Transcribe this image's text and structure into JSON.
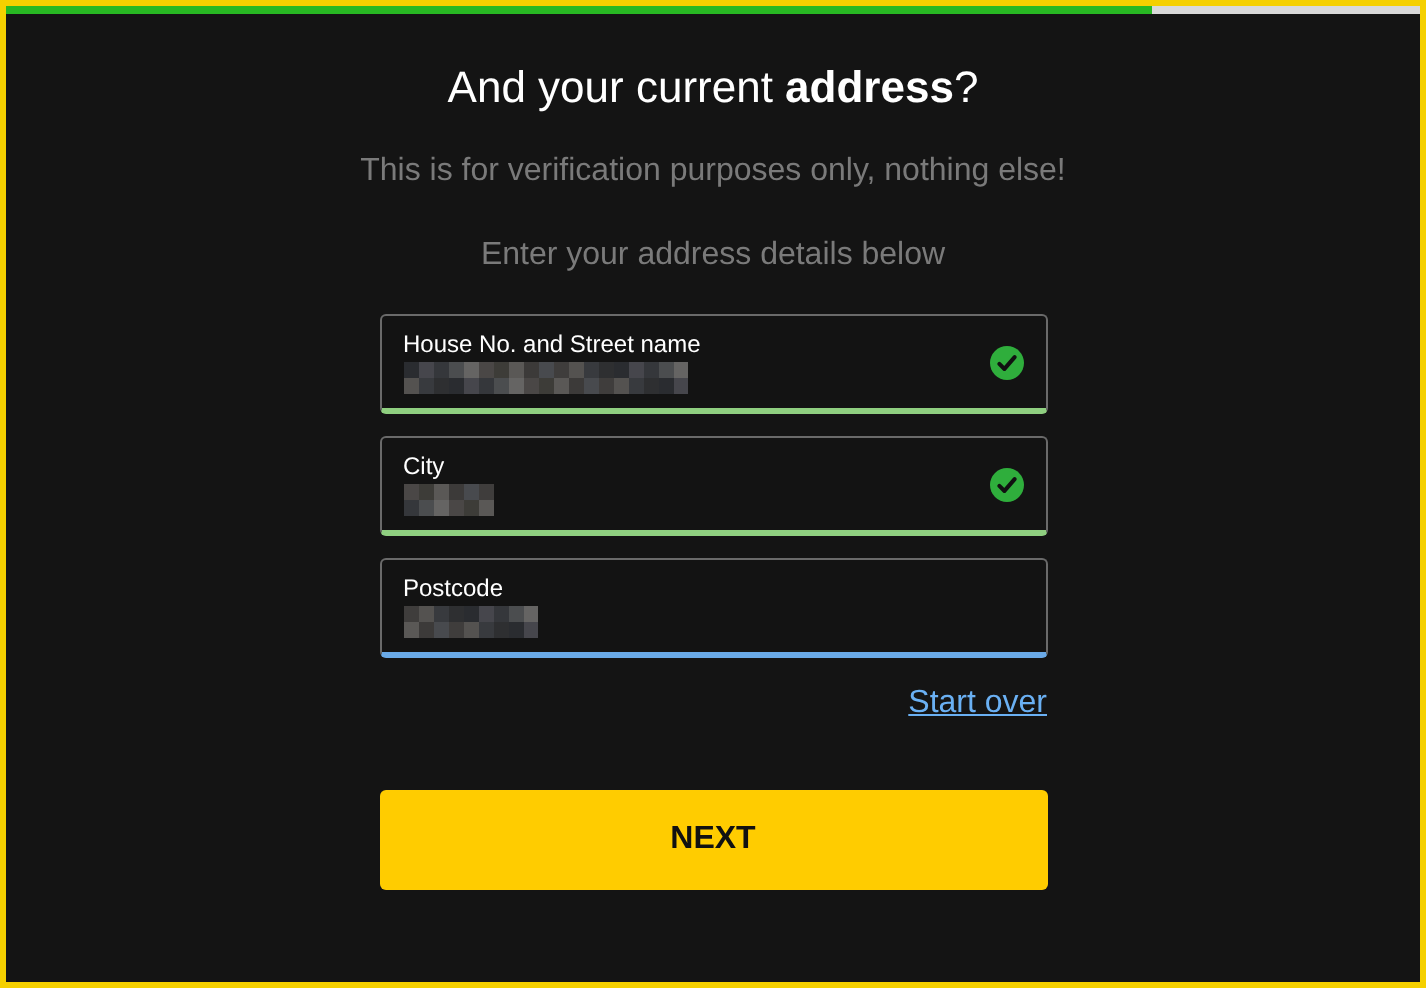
{
  "progress": {
    "level": 0.81
  },
  "title": "And your current **address**?",
  "subtitle": "This is for verification purposes only, nothing else!",
  "instruction": "Enter your address details below",
  "fields": [
    {
      "label": "House No. and Street name",
      "valid": true,
      "focused": false
    },
    {
      "label": "City",
      "valid": true,
      "focused": false
    },
    {
      "label": "Postcode",
      "valid": false,
      "focused": true
    }
  ],
  "link": "Start over",
  "button": "NEXT"
}
